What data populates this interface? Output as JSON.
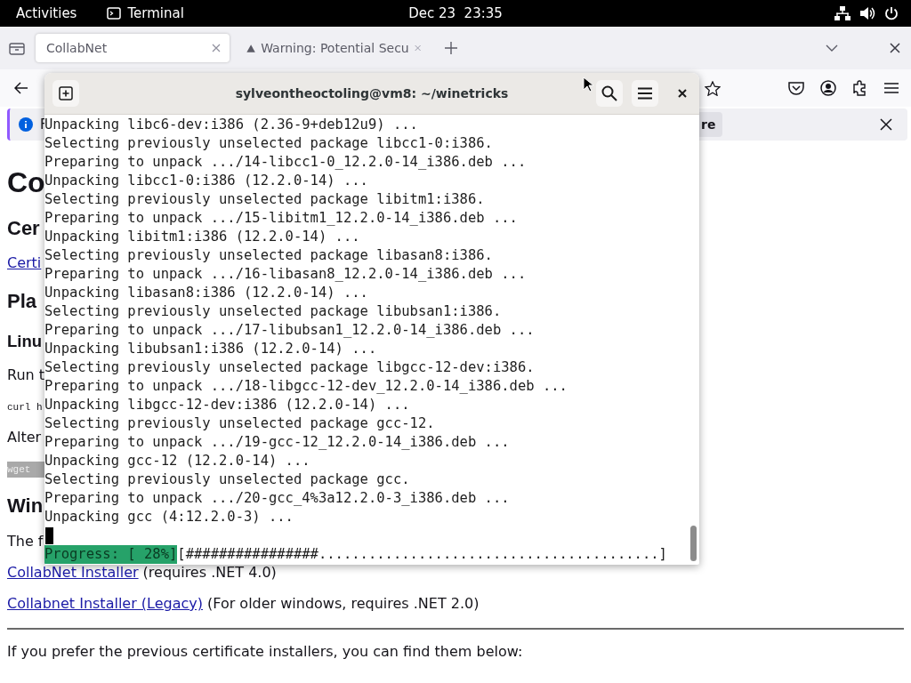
{
  "top_bar": {
    "activities": "Activities",
    "app": "Terminal",
    "clock": "Dec 23  23:35"
  },
  "tabs": [
    {
      "title": "CollabNet",
      "selected": true,
      "kind": "page"
    },
    {
      "title": "Warning: Potential Secu",
      "selected": false,
      "kind": "warning"
    }
  ],
  "notification": {
    "text": "F",
    "button": "re"
  },
  "page": {
    "blocks": [
      {
        "kind": "h1",
        "text": "Co"
      },
      {
        "kind": "h2",
        "text": "Cer"
      },
      {
        "kind": "link",
        "link": "Certi"
      },
      {
        "kind": "h2",
        "text": "Pla"
      },
      {
        "kind": "h3",
        "text": "Linu"
      },
      {
        "kind": "p",
        "text": "Run t"
      },
      {
        "kind": "code",
        "text": "curl h"
      },
      {
        "kind": "p",
        "text": "Alter"
      },
      {
        "kind": "hlcode",
        "text": "wget"
      },
      {
        "kind": "h2",
        "text": "Win"
      },
      {
        "kind": "p",
        "text": "The f"
      },
      {
        "kind": "link",
        "link": "CollabNet Installer",
        "text": "(requires .NET 4.0)"
      },
      {
        "kind": "link",
        "link": "Collabnet Installer (Legacy)",
        "text": "(For older windows, requires .NET 2.0)"
      },
      {
        "kind": "rule"
      },
      {
        "kind": "p",
        "text": "If you prefer the previous certificate installers, you can find them below:"
      }
    ]
  },
  "terminal": {
    "title": "sylveontheoctoling@vm8: ~/winetricks",
    "lines": [
      "Unpacking libc6-dev:i386 (2.36-9+deb12u9) ...",
      "Selecting previously unselected package libcc1-0:i386.",
      "Preparing to unpack .../14-libcc1-0_12.2.0-14_i386.deb ...",
      "Unpacking libcc1-0:i386 (12.2.0-14) ...",
      "Selecting previously unselected package libitm1:i386.",
      "Preparing to unpack .../15-libitm1_12.2.0-14_i386.deb ...",
      "Unpacking libitm1:i386 (12.2.0-14) ...",
      "Selecting previously unselected package libasan8:i386.",
      "Preparing to unpack .../16-libasan8_12.2.0-14_i386.deb ...",
      "Unpacking libasan8:i386 (12.2.0-14) ...",
      "Selecting previously unselected package libubsan1:i386.",
      "Preparing to unpack .../17-libubsan1_12.2.0-14_i386.deb ...",
      "Unpacking libubsan1:i386 (12.2.0-14) ...",
      "Selecting previously unselected package libgcc-12-dev:i386.",
      "Preparing to unpack .../18-libgcc-12-dev_12.2.0-14_i386.deb ...",
      "Unpacking libgcc-12-dev:i386 (12.2.0-14) ...",
      "Selecting previously unselected package gcc-12.",
      "Preparing to unpack .../19-gcc-12_12.2.0-14_i386.deb ...",
      "Unpacking gcc-12 (12.2.0-14) ...",
      "Selecting previously unselected package gcc.",
      "Preparing to unpack .../20-gcc_4%3a12.2.0-3_i386.deb ...",
      "Unpacking gcc (4:12.2.0-3) ..."
    ],
    "progress": {
      "label": "Progress: [ 28%]",
      "bar": "[################.........................................]"
    }
  }
}
